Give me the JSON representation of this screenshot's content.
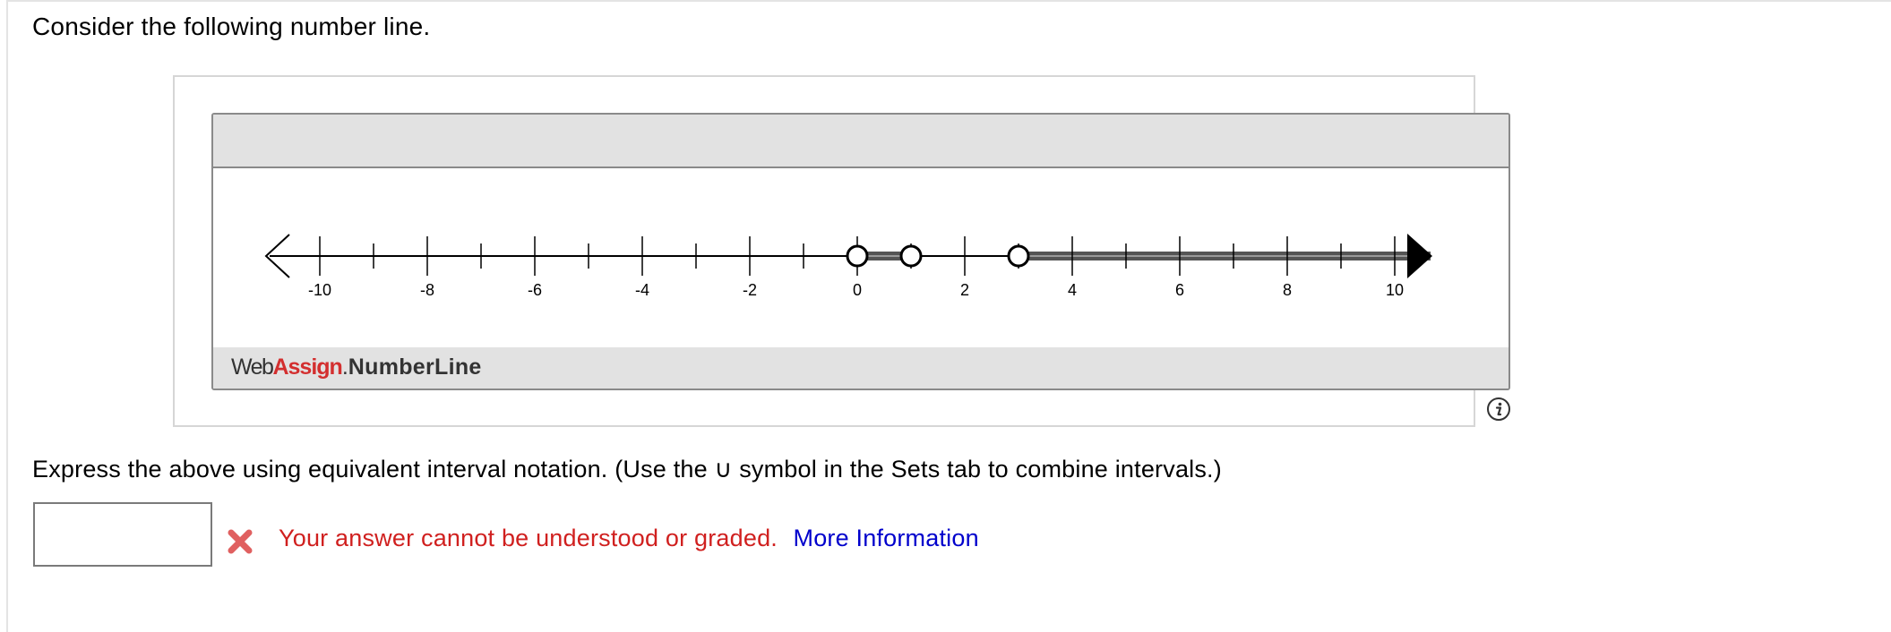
{
  "question": {
    "prompt": "Consider the following number line."
  },
  "number_line": {
    "tick_labels": [
      "-10",
      "-8",
      "-6",
      "-4",
      "-2",
      "0",
      "2",
      "4",
      "6",
      "8",
      "10"
    ],
    "tick_min": -10,
    "tick_max": 10,
    "minor_step": 1,
    "left_end": "open-arrow",
    "right_end": "filled-arrow",
    "shaded_segments": [
      {
        "from": 0,
        "to": 1
      },
      {
        "from": 3,
        "to": "infinity"
      }
    ],
    "open_points": [
      0,
      1,
      3
    ],
    "brand_web": "Web",
    "brand_assign": "Assign",
    "brand_dot": ".",
    "brand_product": "NumberLine",
    "colors": {
      "shade": "#555555",
      "brand_red": "#d32f2f"
    }
  },
  "instruction": {
    "text": "Express the above using equivalent interval notation. (Use the ∪ symbol in the Sets tab to combine intervals.)"
  },
  "answer": {
    "value": "",
    "placeholder": ""
  },
  "feedback": {
    "icon": "error-x-icon",
    "message": "Your answer cannot be understood or graded.",
    "link_text": "More Information",
    "colors": {
      "message": "#d0201f",
      "link": "#0000cc"
    }
  },
  "info_icon": "info-icon"
}
